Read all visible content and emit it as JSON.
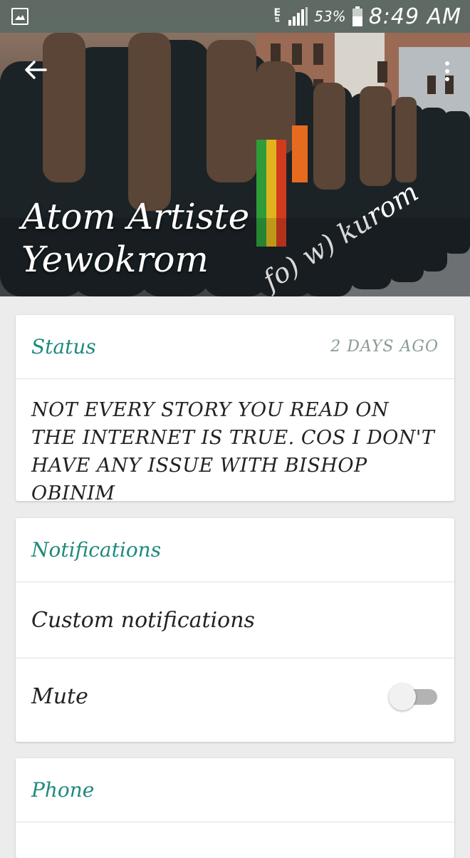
{
  "status_bar": {
    "network_label": "E",
    "battery_percent": "53%",
    "time": "8:49 AM",
    "left_icon": "image-icon",
    "icons": [
      "network-icon",
      "signal-icon",
      "battery-icon"
    ]
  },
  "header": {
    "contact_name_line1": "Atom Artiste",
    "contact_name_line2": "Yewokrom",
    "watermark": "fo) w) kurom",
    "back_icon": "arrow-left-icon",
    "menu_icon": "more-vertical-icon"
  },
  "status_card": {
    "title": "Status",
    "time_ago": "2 DAYS AGO",
    "text": "NOT EVERY STORY YOU READ ON THE INTERNET IS TRUE. COS I DON'T HAVE ANY ISSUE WITH BISHOP OBINIM"
  },
  "notifications_card": {
    "title": "Notifications",
    "custom_label": "Custom notifications",
    "mute_label": "Mute",
    "mute_enabled": false
  },
  "phone_card": {
    "title": "Phone"
  },
  "colors": {
    "accent": "#1e8a7c",
    "status_bar": "#5f6a64",
    "background": "#ececec",
    "toggle_off": "#b3b3b3"
  }
}
